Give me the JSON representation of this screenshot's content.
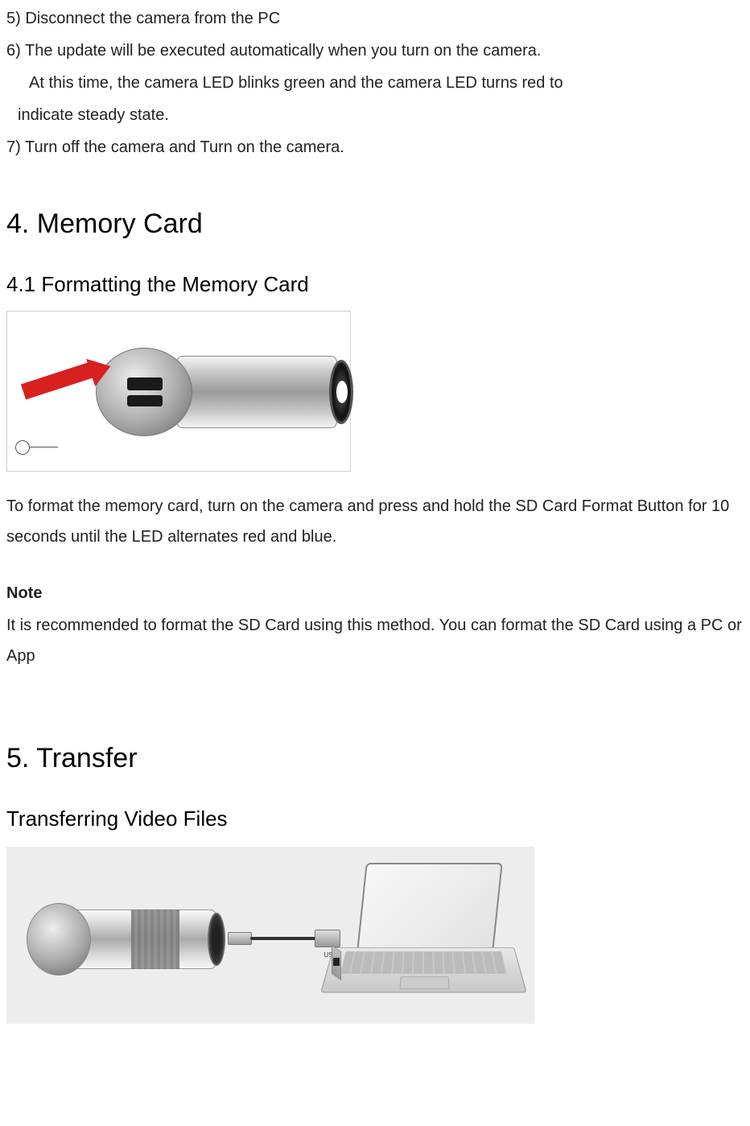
{
  "steps": {
    "s5": "5) Disconnect the camera from the PC",
    "s6_line1": "6) The update will be executed automatically when you turn on the camera.",
    "s6_line2": "At this time, the camera LED blinks green and the camera LED turns red to",
    "s6_line3": "indicate steady state.",
    "s7": "7) Turn off the camera and Turn on the camera."
  },
  "section4": {
    "heading": "4. Memory Card",
    "subheading": "4.1 Formatting the Memory Card",
    "para1": "To format the memory card, turn on the camera and press and hold the SD Card Format Button for 10 seconds until the LED alternates red and blue.",
    "note_label": "Note",
    "note_text": "It is recommended to format the SD Card using this method. You can format the SD Card using a PC or App"
  },
  "section5": {
    "heading": "5. Transfer",
    "subheading": "Transferring Video Files",
    "usb_label": "USB"
  }
}
